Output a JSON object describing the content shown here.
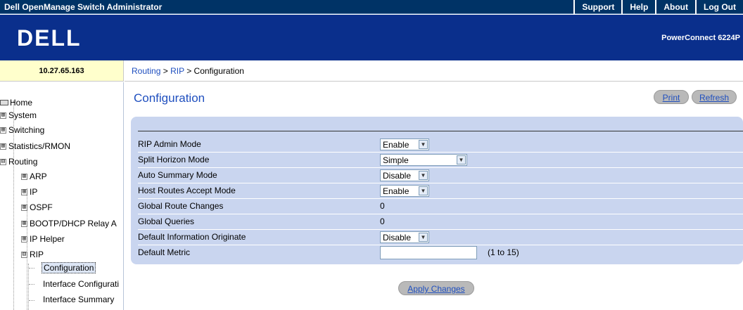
{
  "header": {
    "app_title": "Dell OpenManage Switch Administrator",
    "links": [
      "Support",
      "Help",
      "About",
      "Log Out"
    ],
    "product": "PowerConnect 6224P",
    "logo_text": "DELL"
  },
  "address": {
    "ip": "10.27.65.163",
    "breadcrumb": [
      "Routing",
      "RIP",
      "Configuration"
    ],
    "separator": " > "
  },
  "sidebar": {
    "home": "Home",
    "items": [
      "System",
      "Switching",
      "Statistics/RMON",
      "Routing"
    ],
    "routing_children": [
      "ARP",
      "IP",
      "OSPF",
      "BOOTP/DHCP Relay A",
      "IP Helper",
      "RIP"
    ],
    "rip_children": [
      "Configuration",
      "Interface Configurati",
      "Interface Summary"
    ],
    "expanded_mark": "⊟",
    "collapsed_mark": "⊞"
  },
  "main": {
    "title": "Configuration",
    "print_label": "Print",
    "refresh_label": "Refresh",
    "apply_label": "Apply Changes",
    "fields": [
      {
        "label": "RIP Admin Mode",
        "type": "select",
        "value": "Enable"
      },
      {
        "label": "Split Horizon Mode",
        "type": "select",
        "value": "Simple"
      },
      {
        "label": "Auto Summary Mode",
        "type": "select",
        "value": "Disable"
      },
      {
        "label": "Host Routes Accept Mode",
        "type": "select",
        "value": "Enable"
      },
      {
        "label": "Global Route Changes",
        "type": "text",
        "value": "0"
      },
      {
        "label": "Global Queries",
        "type": "text",
        "value": "0"
      },
      {
        "label": "Default Information Originate",
        "type": "select",
        "value": "Disable"
      },
      {
        "label": "Default Metric",
        "type": "input",
        "value": "",
        "hint": "(1 to 15)"
      }
    ]
  },
  "colors": {
    "topbar": "#003366",
    "banner": "#0a2f8c",
    "panel": "#c9d5ef",
    "link": "#1f4fbf"
  }
}
